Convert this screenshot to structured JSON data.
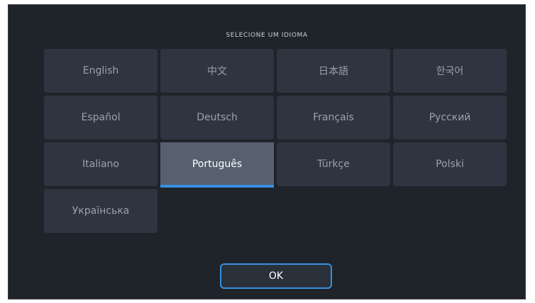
{
  "dialog": {
    "title": "SELECIONE UM IDIOMA",
    "languages": [
      {
        "label": "English"
      },
      {
        "label": "中文"
      },
      {
        "label": "日本語"
      },
      {
        "label": "한국어"
      },
      {
        "label": "Español"
      },
      {
        "label": "Deutsch"
      },
      {
        "label": "Français"
      },
      {
        "label": "Русский"
      },
      {
        "label": "Italiano"
      },
      {
        "label": "Português"
      },
      {
        "label": "Türkçe"
      },
      {
        "label": "Polski"
      },
      {
        "label": "Українська"
      }
    ],
    "selected_language": "Português",
    "ok_label": "OK"
  },
  "colors": {
    "background": "#1f232a",
    "tile": "#2f3540",
    "tile_selected": "#56606f",
    "accent": "#3a8fe0"
  }
}
